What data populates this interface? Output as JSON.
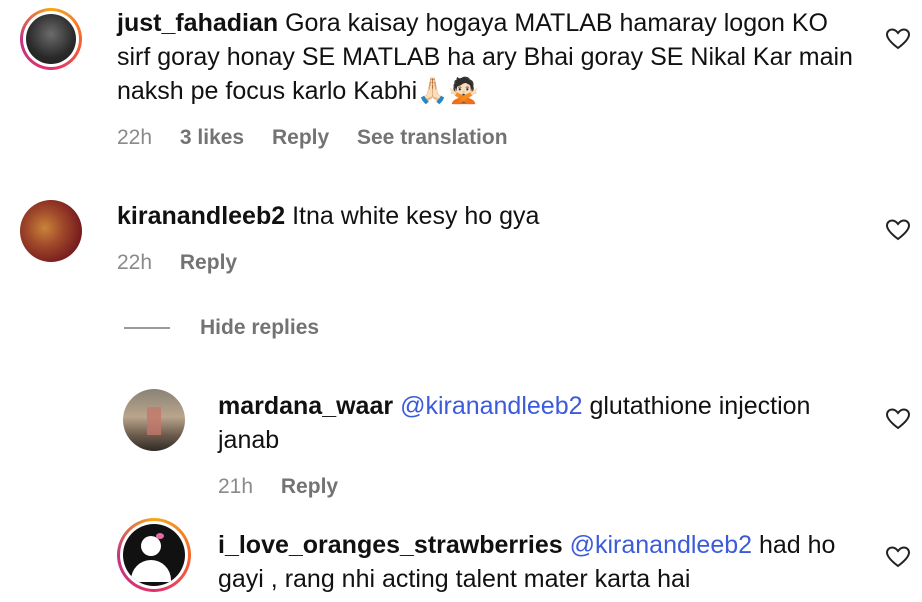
{
  "comments": [
    {
      "username": "just_fahadian",
      "text": "Gora kaisay hogaya MATLAB hamaray logon KO sirf goray honay SE MATLAB ha ary Bhai goray SE Nikal Kar main naksh pe focus karlo Kabhi🙏🏻🙅🏻",
      "time": "22h",
      "likes": "3 likes",
      "reply": "Reply",
      "translate": "See translation"
    },
    {
      "username": "kiranandleeb2",
      "text": "Itna white kesy ho gya",
      "time": "22h",
      "reply": "Reply"
    }
  ],
  "hide_replies": "Hide replies",
  "replies": [
    {
      "username": "mardana_waar",
      "mention": "@kiranandleeb2",
      "text": "glutathione injection janab",
      "time": "21h",
      "reply": "Reply"
    },
    {
      "username": "i_love_oranges_strawberries",
      "mention": "@kiranandleeb2",
      "text": "had ho gayi , rang nhi acting talent mater karta hai"
    }
  ],
  "colors": {
    "mention": "#3b5bdb",
    "meta": "#737373"
  }
}
